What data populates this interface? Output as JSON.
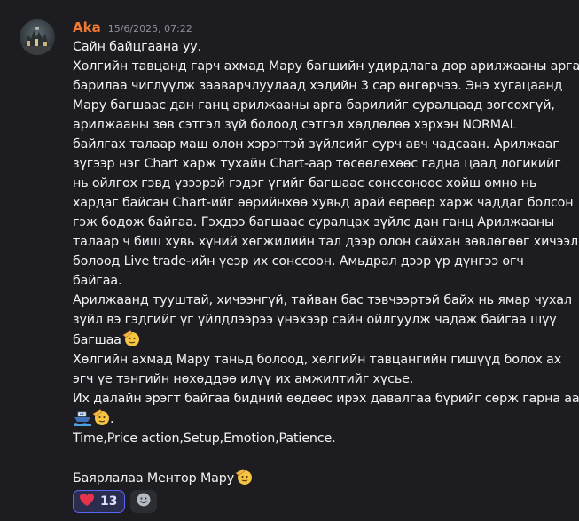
{
  "message": {
    "author": "Aka",
    "timestamp": "15/6/2025, 07:22",
    "author_color": "#f07a33",
    "lines": [
      "Сайн байцгаана уу.",
      "Хөлгийн тавцанд гарч ахмад Мару багшийн удирдлага дор арилжааны арга",
      "барилаа чиглүүлж зааварчлуулаад хэдийн 3 сар өнгөрчээ. Энэ хугацаанд",
      "Мару багшаас дан ганц арилжааны арга барилийг суралцаад зогсохгүй,",
      "арилжааны зөв сэтгэл зүй болоод сэтгэл хөдлөлөө хэрхэн NORMAL",
      "байлгах талаар маш олон хэрэгтэй зүйлсийг сурч авч чадсаан. Арилжааг",
      "зүгээр нэг Chart харж тухайн Chart-аар төсөөлөхөөс гадна цаад логикийг",
      "нь ойлгох гэвд үзээрэй гэдэг үгийг багшаас сонссоноос хойш өмнө нь",
      "хардаг байсан Chart-ийг өөрийнхөө хувьд арай өөрөөр харж чаддаг болсон",
      "гэж бодож байгаа. Гэхдээ багшаас суралцах зүйлс дан ганц Арилжааны",
      "талаар ч биш хувь хүний хөгжилийн тал дээр олон сайхан зөвлөгөөг хичээл",
      "болоод Live trade-ийн үеэр их сонссоон. Амьдрал дээр үр дүнгээ өгч",
      "байгаа.",
      "Арилжаанд тууштай, хичээнгүй, тайван бас тэвчээртэй байх нь ямар чухал",
      "зүйл вэ гэдгийг үг үйлдлээрээ үнэхээр сайн ойлгуулж чадаж байгаа шүү",
      "багшаа",
      "Хөлгийн ахмад Мару таньд болоод, хөлгийн тавцангийн гишүүд болох ах",
      "эгч үе тэнгийн нөхөддөө илүү их амжилтийг хүсье.",
      "Их далайн эрэгт байгаа бидний өөдөөс ирэх давалгаа бүрийг сөрж гарна аа",
      "",
      "Time,Price action,Setup,Emotion,Patience.",
      "",
      "Баярлалаа Ментор Мару"
    ],
    "line_suffix_emojis": {
      "15": "saluting-face",
      "22": "saluting-face"
    },
    "standalone_emoji_line": [
      "ship",
      "saluting-face"
    ],
    "standalone_emoji_line_trailing_text": "."
  },
  "reactions": [
    {
      "emoji": "red-heart",
      "count": "13",
      "selected": true
    }
  ],
  "add_reaction": {
    "icon": "smiley-add-icon"
  },
  "colors": {
    "background": "#1c1c21",
    "text": "#f2f3f5",
    "timestamp": "#8e9099",
    "reaction_bg": "#2a2d4e",
    "reaction_border": "#5865f2"
  }
}
